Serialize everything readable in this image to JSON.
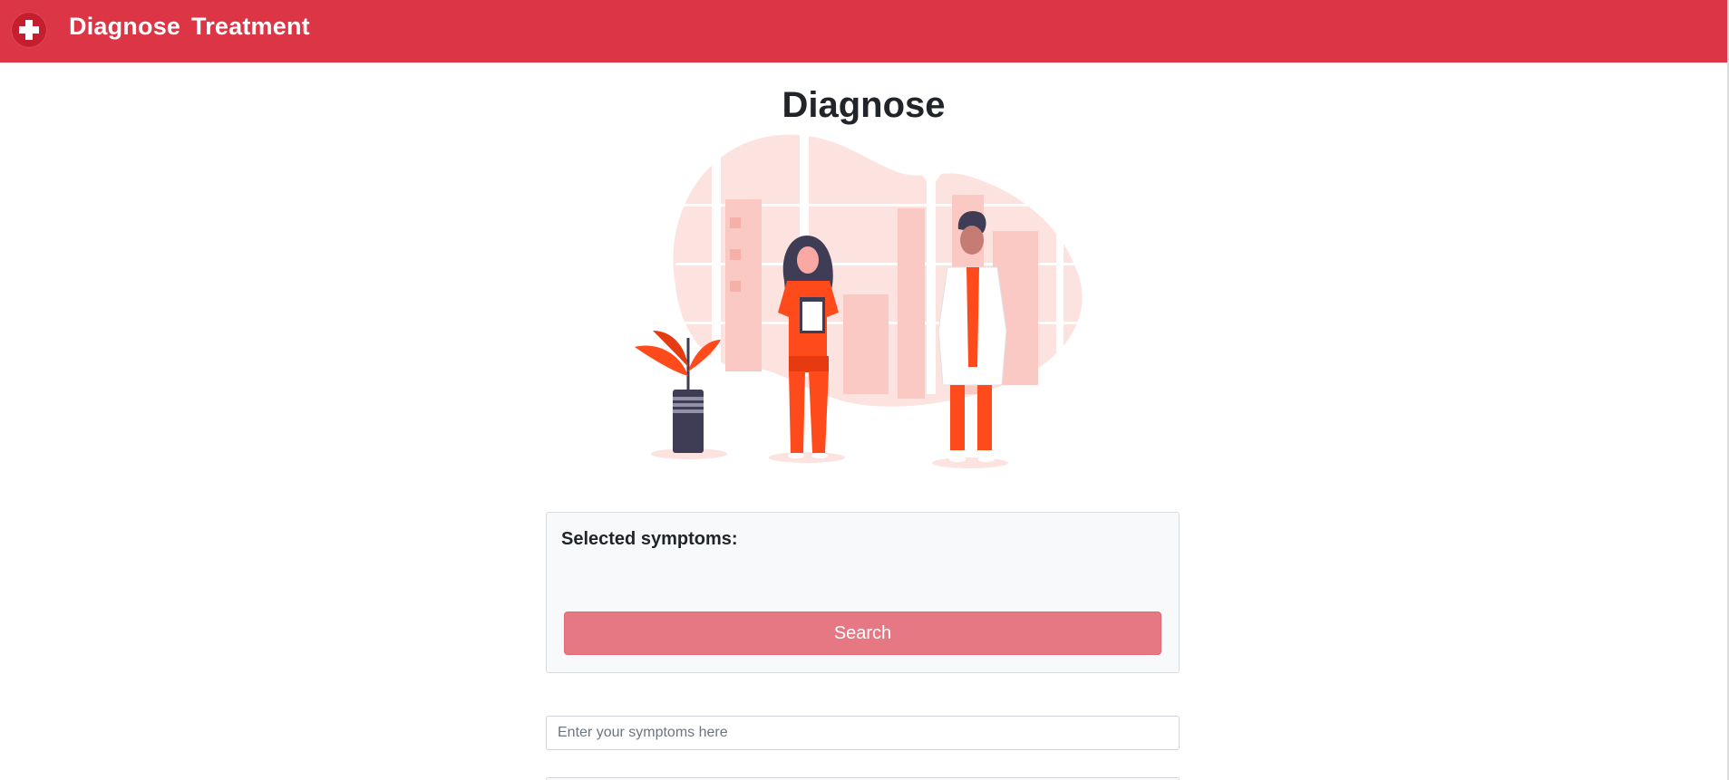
{
  "navbar": {
    "logo_icon": "medical-cross-icon",
    "links": [
      {
        "label": "Diagnose"
      },
      {
        "label": "Treatment"
      }
    ],
    "background_color": "#dc3545"
  },
  "main": {
    "title": "Diagnose",
    "illustration": "doctors-illustration",
    "symptoms_card": {
      "label": "Selected symptoms:",
      "search_label": "Search"
    },
    "symptom_input": {
      "placeholder": "Enter your symptoms here",
      "value": ""
    }
  },
  "colors": {
    "accent": "#dc3545",
    "button_disabled": "#e57882",
    "illustration_primary": "#ff4a1c",
    "illustration_bg": "#fde3e0"
  }
}
